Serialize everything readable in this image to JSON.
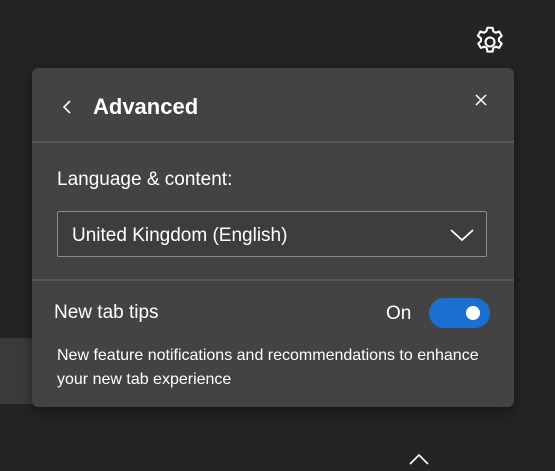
{
  "panel": {
    "title": "Advanced",
    "icons": {
      "back": "chevron-left-icon",
      "close": "close-icon",
      "settings": "gear-icon",
      "scroll_up": "chevron-up-icon"
    },
    "language": {
      "label": "Language & content:",
      "selected": "United Kingdom (English)"
    },
    "new_tab_tips": {
      "label": "New tab tips",
      "state": "On",
      "enabled": true,
      "description": "New feature notifications and recommendations to enhance your new tab experience"
    }
  },
  "colors": {
    "background": "#242424",
    "panel": "#434343",
    "toggle_on": "#1a6fd1"
  }
}
